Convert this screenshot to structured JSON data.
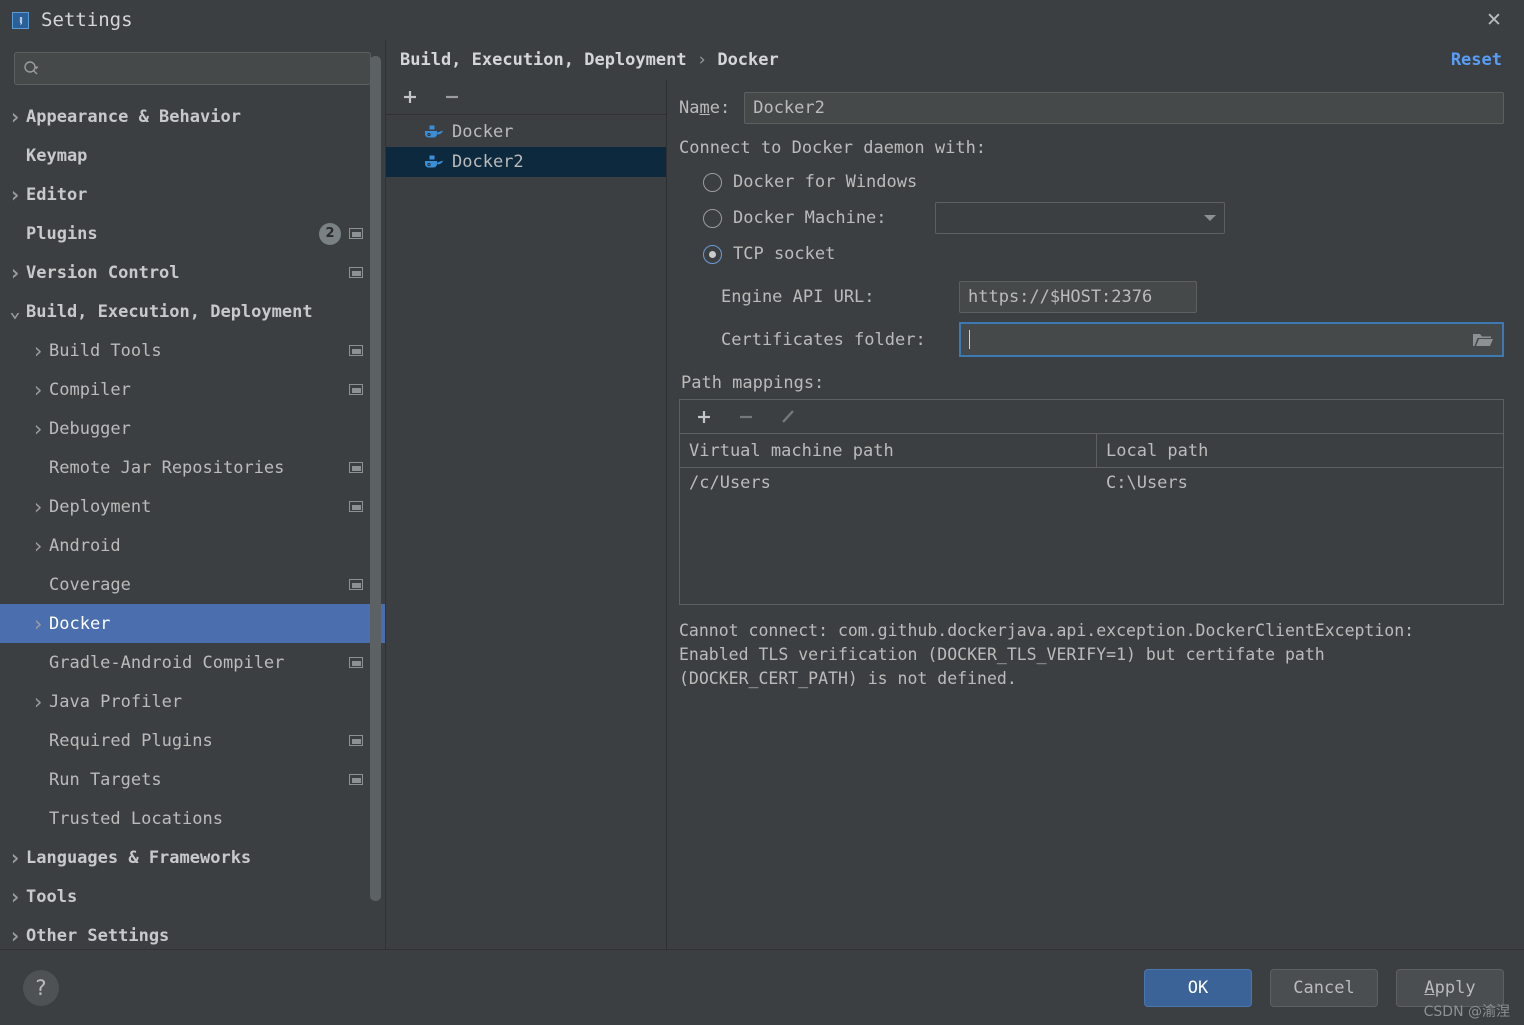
{
  "window": {
    "title": "Settings",
    "app_icon": "intellij-idea-icon",
    "close_label": "✕"
  },
  "search": {
    "value": "",
    "placeholder": ""
  },
  "sidebar": {
    "items": [
      {
        "label": "Appearance & Behavior",
        "level": 0,
        "arrow": "collapsed",
        "bold": true,
        "badge": "",
        "modified": false,
        "selected": false
      },
      {
        "label": "Keymap",
        "level": 0,
        "arrow": "none",
        "bold": true,
        "badge": "",
        "modified": false,
        "selected": false
      },
      {
        "label": "Editor",
        "level": 0,
        "arrow": "collapsed",
        "bold": true,
        "badge": "",
        "modified": false,
        "selected": false
      },
      {
        "label": "Plugins",
        "level": 0,
        "arrow": "none",
        "bold": true,
        "badge": "2",
        "modified": true,
        "selected": false
      },
      {
        "label": "Version Control",
        "level": 0,
        "arrow": "collapsed",
        "bold": true,
        "badge": "",
        "modified": true,
        "selected": false
      },
      {
        "label": "Build, Execution, Deployment",
        "level": 0,
        "arrow": "expanded",
        "bold": true,
        "badge": "",
        "modified": false,
        "selected": false
      },
      {
        "label": "Build Tools",
        "level": 1,
        "arrow": "collapsed",
        "bold": false,
        "badge": "",
        "modified": true,
        "selected": false
      },
      {
        "label": "Compiler",
        "level": 1,
        "arrow": "collapsed",
        "bold": false,
        "badge": "",
        "modified": true,
        "selected": false
      },
      {
        "label": "Debugger",
        "level": 1,
        "arrow": "collapsed",
        "bold": false,
        "badge": "",
        "modified": false,
        "selected": false
      },
      {
        "label": "Remote Jar Repositories",
        "level": 1,
        "arrow": "none",
        "bold": false,
        "badge": "",
        "modified": true,
        "selected": false
      },
      {
        "label": "Deployment",
        "level": 1,
        "arrow": "collapsed",
        "bold": false,
        "badge": "",
        "modified": true,
        "selected": false
      },
      {
        "label": "Android",
        "level": 1,
        "arrow": "collapsed",
        "bold": false,
        "badge": "",
        "modified": false,
        "selected": false
      },
      {
        "label": "Coverage",
        "level": 1,
        "arrow": "none",
        "bold": false,
        "badge": "",
        "modified": true,
        "selected": false
      },
      {
        "label": "Docker",
        "level": 1,
        "arrow": "collapsed",
        "bold": false,
        "badge": "",
        "modified": false,
        "selected": true
      },
      {
        "label": "Gradle-Android Compiler",
        "level": 1,
        "arrow": "none",
        "bold": false,
        "badge": "",
        "modified": true,
        "selected": false
      },
      {
        "label": "Java Profiler",
        "level": 1,
        "arrow": "collapsed",
        "bold": false,
        "badge": "",
        "modified": false,
        "selected": false
      },
      {
        "label": "Required Plugins",
        "level": 1,
        "arrow": "none",
        "bold": false,
        "badge": "",
        "modified": true,
        "selected": false
      },
      {
        "label": "Run Targets",
        "level": 1,
        "arrow": "none",
        "bold": false,
        "badge": "",
        "modified": true,
        "selected": false
      },
      {
        "label": "Trusted Locations",
        "level": 1,
        "arrow": "none",
        "bold": false,
        "badge": "",
        "modified": false,
        "selected": false
      },
      {
        "label": "Languages & Frameworks",
        "level": 0,
        "arrow": "collapsed",
        "bold": true,
        "badge": "",
        "modified": false,
        "selected": false
      },
      {
        "label": "Tools",
        "level": 0,
        "arrow": "collapsed",
        "bold": true,
        "badge": "",
        "modified": false,
        "selected": false
      },
      {
        "label": "Other Settings",
        "level": 0,
        "arrow": "collapsed",
        "bold": true,
        "badge": "",
        "modified": false,
        "selected": false
      }
    ]
  },
  "main": {
    "breadcrumb_root": "Build, Execution, Deployment",
    "breadcrumb_sep": "›",
    "breadcrumb_leaf": "Docker",
    "reset_label": "Reset"
  },
  "server_list": {
    "add_label": "+",
    "remove_label": "−",
    "items": [
      {
        "label": "Docker",
        "selected": false
      },
      {
        "label": "Docker2",
        "selected": true
      }
    ]
  },
  "form": {
    "name_label_pre": "Na",
    "name_label_mn": "m",
    "name_label_post": "e:",
    "name_value": "Docker2",
    "connect_title": "Connect to Docker daemon with:",
    "radios": [
      {
        "label": "Docker for Windows",
        "checked": false
      },
      {
        "label": "Docker Machine:",
        "checked": false
      },
      {
        "label": "TCP socket",
        "checked": true
      }
    ],
    "machine_combo_value": "",
    "api_url_label": "Engine API URL:",
    "api_url_value": "https://$HOST:2376",
    "cert_label": "Certificates folder:",
    "cert_value": "",
    "browse_icon": "folder-icon"
  },
  "path_mappings": {
    "title": "Path mappings:",
    "add_label": "+",
    "remove_label": "−",
    "edit_label": "edit-pencil-icon",
    "columns": [
      "Virtual machine path",
      "Local path"
    ],
    "rows": [
      {
        "vm": "/c/Users",
        "local": "C:\\Users"
      }
    ]
  },
  "error": {
    "text": "Cannot connect: com.github.dockerjava.api.exception.DockerClientException:\nEnabled TLS verification (DOCKER_TLS_VERIFY=1) but certifate path\n(DOCKER_CERT_PATH) is not defined."
  },
  "footer": {
    "help_label": "?",
    "ok_label": "OK",
    "cancel_label": "Cancel",
    "apply_label_pre": "",
    "apply_label_mn": "A",
    "apply_label_post": "pply",
    "watermark": "CSDN @渝涅"
  },
  "colors": {
    "window_bg": "#3c3f41",
    "selection_blue": "#4b6eaf",
    "list_selection": "#0d293e",
    "accent_link": "#589df6",
    "focus_border": "#3d7ab3",
    "docker_blue": "#3a8fd9",
    "ok_button": "#3c6398"
  }
}
